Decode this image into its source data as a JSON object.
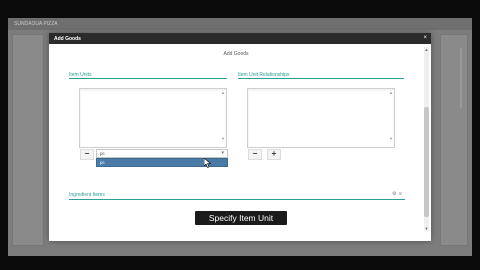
{
  "app": {
    "title": "SUNDAOUA PIZZA"
  },
  "modal": {
    "title": "Add Goods",
    "close": "×",
    "subtitle": "Add Goods",
    "sections": {
      "item_units": {
        "label": "Item Units"
      },
      "item_unit_relationships": {
        "label": "Item Unit Relationships"
      },
      "ingredient_items": {
        "label": "Ingredient Items"
      }
    },
    "unit_select": {
      "value": "pc",
      "options": [
        "pc"
      ]
    },
    "buttons": {
      "minus": "−",
      "plus": "+"
    }
  },
  "caption": {
    "text": "Specify Item Unit"
  },
  "icons": [
    "close-icon",
    "minus-icon",
    "plus-icon",
    "chevron-down-icon",
    "mouse-cursor-icon",
    "gear-icon",
    "list-icon"
  ]
}
